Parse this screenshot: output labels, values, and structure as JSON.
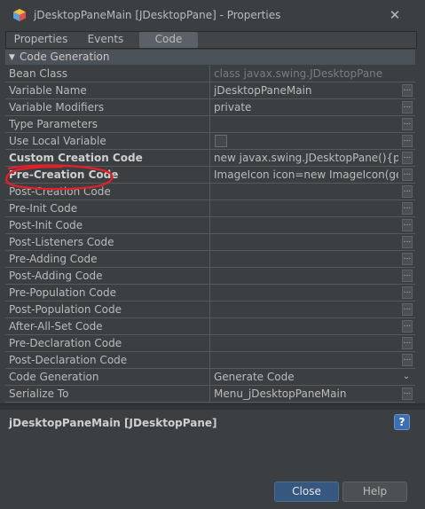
{
  "window": {
    "title": "jDesktopPaneMain [JDesktopPane] - Properties"
  },
  "tabs": [
    {
      "label": "Properties",
      "selected": false
    },
    {
      "label": "Events",
      "selected": false
    },
    {
      "label": "Code",
      "selected": true
    }
  ],
  "section": {
    "label": "Code Generation",
    "expanded": true
  },
  "rows": [
    {
      "name": "Bean Class",
      "value": "class javax.swing.JDesktopPane",
      "bold": false,
      "editor": "none",
      "disabled": true
    },
    {
      "name": "Variable Name",
      "value": "jDesktopPaneMain",
      "bold": false,
      "editor": "dots"
    },
    {
      "name": "Variable Modifiers",
      "value": "private",
      "bold": false,
      "editor": "dots"
    },
    {
      "name": "Type Parameters",
      "value": "",
      "bold": false,
      "editor": "dots"
    },
    {
      "name": "Use Local Variable",
      "value": "",
      "bold": false,
      "editor": "checkbox",
      "checked": false
    },
    {
      "name": "Custom Creation Code",
      "value": "new javax.swing.JDesktopPane(){publi...",
      "bold": true,
      "editor": "dots"
    },
    {
      "name": "Pre-Creation Code",
      "value": "ImageIcon icon=new ImageIcon(getC...",
      "bold": true,
      "editor": "dots"
    },
    {
      "name": "Post-Creation Code",
      "value": "",
      "bold": false,
      "editor": "dots"
    },
    {
      "name": "Pre-Init Code",
      "value": "",
      "bold": false,
      "editor": "dots"
    },
    {
      "name": "Post-Init Code",
      "value": "",
      "bold": false,
      "editor": "dots"
    },
    {
      "name": "Post-Listeners Code",
      "value": "",
      "bold": false,
      "editor": "dots"
    },
    {
      "name": "Pre-Adding Code",
      "value": "",
      "bold": false,
      "editor": "dots"
    },
    {
      "name": "Post-Adding Code",
      "value": "",
      "bold": false,
      "editor": "dots"
    },
    {
      "name": "Pre-Population Code",
      "value": "",
      "bold": false,
      "editor": "dots"
    },
    {
      "name": "Post-Population Code",
      "value": "",
      "bold": false,
      "editor": "dots"
    },
    {
      "name": "After-All-Set Code",
      "value": "",
      "bold": false,
      "editor": "dots"
    },
    {
      "name": "Pre-Declaration Code",
      "value": "",
      "bold": false,
      "editor": "dots"
    },
    {
      "name": "Post-Declaration Code",
      "value": "",
      "bold": false,
      "editor": "dots"
    },
    {
      "name": "Code Generation",
      "value": "Generate Code",
      "bold": false,
      "editor": "dropdown"
    },
    {
      "name": "Serialize To",
      "value": "Menu_jDesktopPaneMain",
      "bold": false,
      "editor": "dots"
    }
  ],
  "description": {
    "title": "jDesktopPaneMain [JDesktopPane]"
  },
  "buttons": {
    "close": "Close",
    "help": "Help"
  },
  "colors": {
    "annotation": "#e0202a",
    "accent": "#365880"
  }
}
